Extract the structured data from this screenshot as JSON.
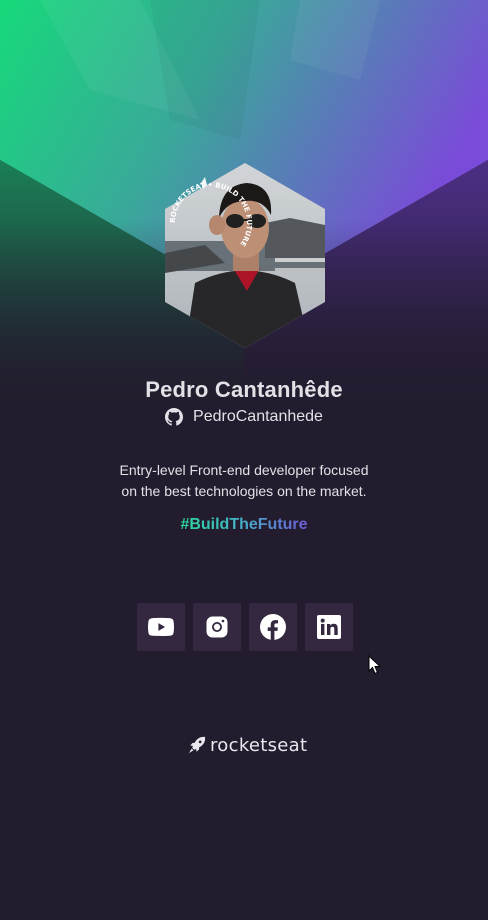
{
  "profile": {
    "name": "Pedro Cantanhêde",
    "username": "PedroCantanhede",
    "bio_line1": "Entry-level Front-end developer focused",
    "bio_line2": "on the best technologies on the market.",
    "hashtag": "#BuildTheFuture",
    "badge_text": "ROCKETSEAT • BUILD THE FUTURE"
  },
  "socials": [
    {
      "name": "youtube",
      "icon": "youtube-icon"
    },
    {
      "name": "instagram",
      "icon": "instagram-icon"
    },
    {
      "name": "facebook",
      "icon": "facebook-icon"
    },
    {
      "name": "linkedin",
      "icon": "linkedin-icon"
    }
  ],
  "brand": {
    "name": "rocketseat",
    "icon": "rocket-icon"
  },
  "colors": {
    "background": "#231c2e",
    "social_button": "#33283f",
    "text": "#e1e1e6",
    "gradient_green": "#1bd67a",
    "gradient_purple": "#7a4fd6"
  }
}
